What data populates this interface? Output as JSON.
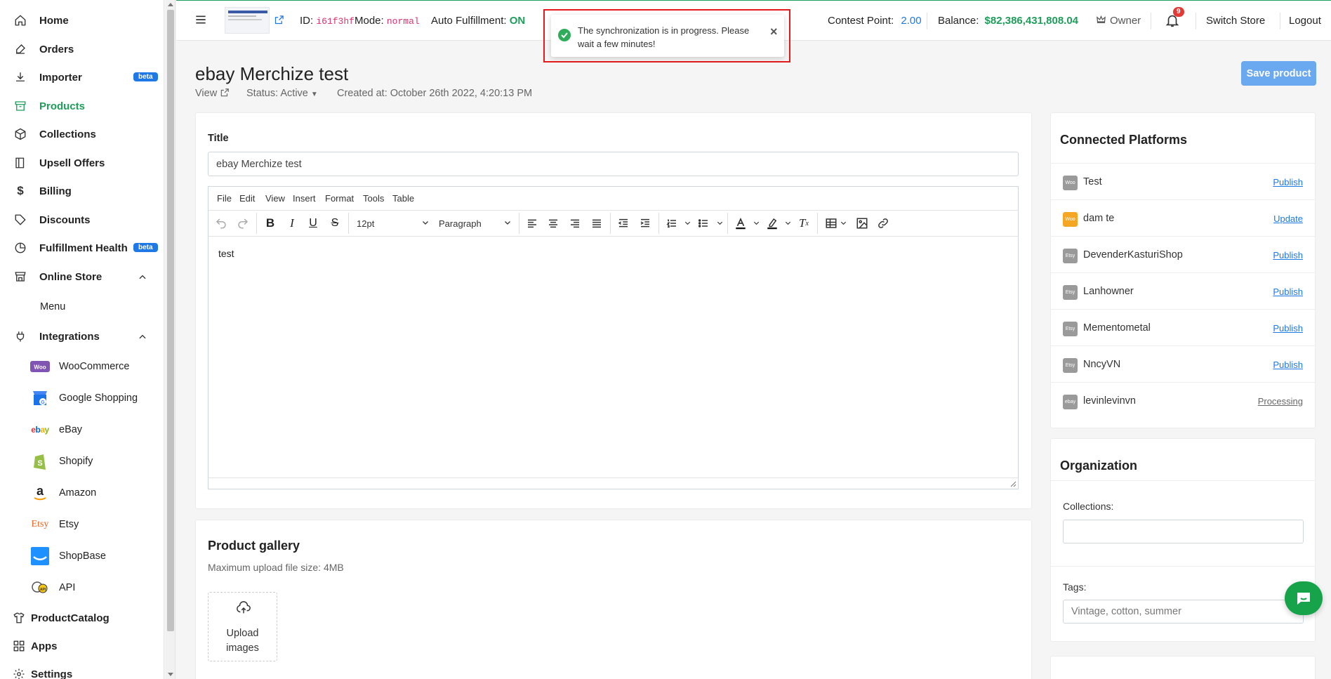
{
  "sidebar": {
    "items": [
      {
        "label": "Home",
        "icon": "home-icon"
      },
      {
        "label": "Orders",
        "icon": "edit-icon"
      },
      {
        "label": "Importer",
        "icon": "download-icon",
        "badge": "beta"
      },
      {
        "label": "Products",
        "icon": "archive-icon",
        "active": true
      },
      {
        "label": "Collections",
        "icon": "box-icon"
      },
      {
        "label": "Upsell Offers",
        "icon": "book-icon"
      },
      {
        "label": "Billing",
        "icon": "dollar-icon"
      },
      {
        "label": "Discounts",
        "icon": "tag-icon"
      },
      {
        "label": "Fulfillment Health",
        "icon": "chart-pie-icon",
        "badge": "beta"
      },
      {
        "label": "Online Store",
        "icon": "store-icon"
      },
      {
        "label": "Menu"
      },
      {
        "label": "Integrations",
        "icon": "plug-icon"
      },
      {
        "label": "ProductCatalog",
        "icon": "shirt-icon"
      },
      {
        "label": "Apps",
        "icon": "apps-icon"
      },
      {
        "label": "Settings",
        "icon": "gear-icon"
      }
    ],
    "integrations": [
      {
        "label": "WooCommerce",
        "logo": "woocommerce-logo"
      },
      {
        "label": "Google Shopping",
        "logo": "google-shopping-logo"
      },
      {
        "label": "eBay",
        "logo": "ebay-logo"
      },
      {
        "label": "Shopify",
        "logo": "shopify-logo"
      },
      {
        "label": "Amazon",
        "logo": "amazon-logo"
      },
      {
        "label": "Etsy",
        "logo": "etsy-logo"
      },
      {
        "label": "ShopBase",
        "logo": "shopbase-logo"
      },
      {
        "label": "API",
        "logo": "api-logo"
      }
    ]
  },
  "header": {
    "id_label": "ID:",
    "id_value": "i61f3hf",
    "mode_label": "Mode:",
    "mode_value": "normal",
    "auto_label": "Auto Fulfillment:",
    "auto_value": "ON",
    "contest_label": "Contest Point:",
    "contest_value": "2.00",
    "balance_label": "Balance:",
    "balance_value": "$82,386,431,808.04",
    "owner": "Owner",
    "notif_count": "9",
    "switch_store": "Switch Store",
    "logout": "Logout"
  },
  "toast": {
    "message": "The synchronization is in progress. Please wait a few minutes!",
    "close": "×"
  },
  "product": {
    "title": "ebay Merchize test",
    "view": "View",
    "status": "Status: Active",
    "created": "Created at: October 26th 2022, 4:20:13 PM",
    "save": "Save product",
    "title_label": "Title",
    "title_value": "ebay Merchize test",
    "editor_menu": [
      "File",
      "Edit",
      "View",
      "Insert",
      "Format",
      "Tools",
      "Table"
    ],
    "font_size": "12pt",
    "block": "Paragraph",
    "body": "test"
  },
  "gallery": {
    "title": "Product gallery",
    "hint": "Maximum upload file size: 4MB",
    "upload_line1": "Upload",
    "upload_line2": "images"
  },
  "platforms": {
    "title": "Connected Platforms",
    "rows": [
      {
        "name": "Test",
        "type": "Woo",
        "action": "Publish",
        "color": "#9a9a9a"
      },
      {
        "name": "dam te",
        "type": "Woo",
        "action": "Update",
        "color": "#f5a623"
      },
      {
        "name": "DevenderKasturiShop",
        "type": "Etsy",
        "action": "Publish",
        "color": "#9a9a9a"
      },
      {
        "name": "Lanhowner",
        "type": "Etsy",
        "action": "Publish",
        "color": "#9a9a9a"
      },
      {
        "name": "Mementometal",
        "type": "Etsy",
        "action": "Publish",
        "color": "#9a9a9a"
      },
      {
        "name": "NncyVN",
        "type": "Etsy",
        "action": "Publish",
        "color": "#9a9a9a"
      },
      {
        "name": "levinlevinvn",
        "type": "ebay",
        "action": "Processing",
        "color": "#9a9a9a"
      }
    ]
  },
  "organization": {
    "title": "Organization",
    "collections_label": "Collections:",
    "tags_label": "Tags:",
    "tags_placeholder": "Vintage, cotton, summer"
  },
  "colors": {
    "accent": "#1e9e5a",
    "link": "#1e78e6",
    "danger": "#e41b1b"
  }
}
